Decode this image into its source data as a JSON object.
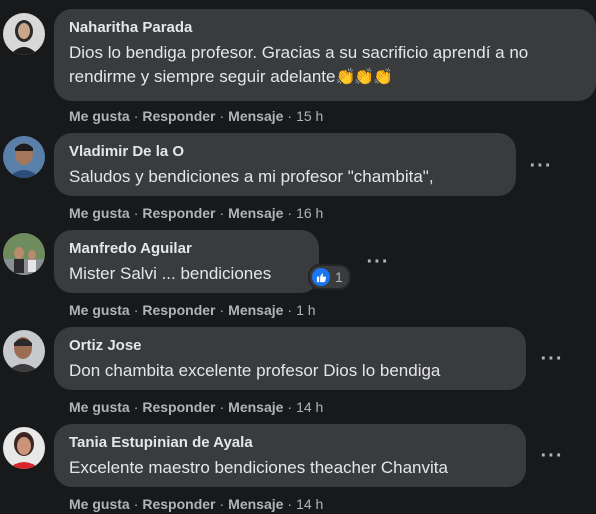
{
  "comments": [
    {
      "author": "Naharitha Parada",
      "text": "Dios lo bendiga profesor. Gracias a su sacrificio aprendí a no rendirme y siempre seguir adelante",
      "emoji": "👏👏👏",
      "actions": {
        "like": "Me gusta",
        "reply": "Responder",
        "message": "Mensaje",
        "time": "15 h"
      }
    },
    {
      "author": "Vladimir De la O",
      "text": "Saludos y bendiciones a mi profesor \"chambita\",",
      "actions": {
        "like": "Me gusta",
        "reply": "Responder",
        "message": "Mensaje",
        "time": "16 h"
      }
    },
    {
      "author": "Manfredo Aguilar",
      "text": "Mister Salvi ... bendiciones",
      "reaction_count": "1",
      "actions": {
        "like": "Me gusta",
        "reply": "Responder",
        "message": "Mensaje",
        "time": "1 h"
      }
    },
    {
      "author": "Ortiz Jose",
      "text": "Don chambita excelente profesor Dios lo bendiga",
      "actions": {
        "like": "Me gusta",
        "reply": "Responder",
        "message": "Mensaje",
        "time": "14 h"
      }
    },
    {
      "author": "Tania Estupinian de Ayala",
      "text": "Excelente maestro bendiciones theacher Chanvita",
      "actions": {
        "like": "Me gusta",
        "reply": "Responder",
        "message": "Mensaje",
        "time": "14 h"
      }
    }
  ],
  "separator": "·",
  "more_icon": "more-options-icon",
  "colors": {
    "background": "#18191a",
    "bubble": "#3a3b3c",
    "text": "#e4e6eb",
    "secondary": "#b0b3b8",
    "like_blue": "#1877f2"
  }
}
